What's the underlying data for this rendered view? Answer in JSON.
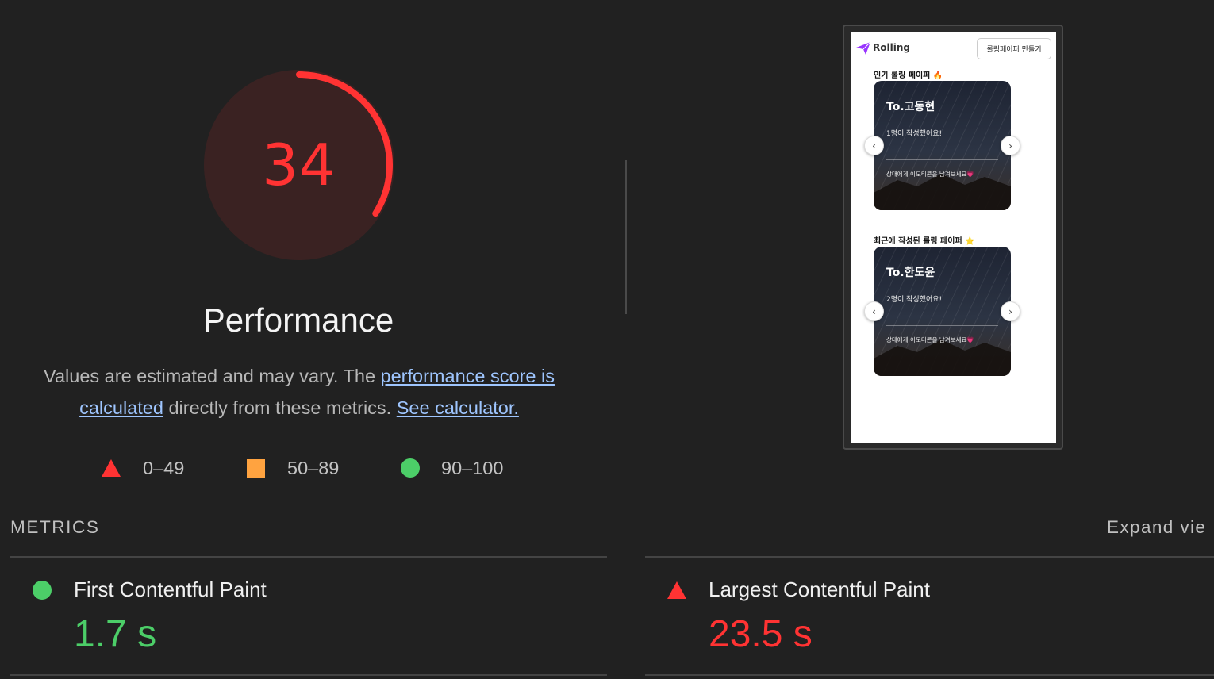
{
  "score": {
    "value": "34",
    "fraction": 0.34,
    "color": "#ff3333"
  },
  "category": "Performance",
  "description": {
    "before": "Values are estimated and may vary. The ",
    "link1": "performance score is calculated",
    "middle": " directly from these metrics. ",
    "link2": "See calculator."
  },
  "legend": [
    {
      "icon": "triangle-icon",
      "label": "0–49",
      "color": "#ff3333"
    },
    {
      "icon": "square-icon",
      "label": "50–89",
      "color": "#ffa340"
    },
    {
      "icon": "circle-icon",
      "label": "90–100",
      "color": "#4cce68"
    }
  ],
  "screenshot": {
    "brand": "Rolling",
    "make_button": "롤링페이퍼 만들기",
    "section1_title": "인기 롤링 페이퍼 🔥",
    "section2_title": "최근에 작성된 롤링 페이퍼 ⭐",
    "card1": {
      "to": "To.고동현",
      "count": "1명이 작성했어요!",
      "cta": "상대에게 이모티콘을 남겨보세요💗"
    },
    "card2": {
      "to": "To.한도윤",
      "count": "2명이 작성했어요!",
      "cta": "상대에게 이모티콘을 남겨보세요💗"
    },
    "prev_glyph": "‹",
    "next_glyph": "›"
  },
  "metrics_title": "METRICS",
  "expand_label": "Expand vie",
  "metrics": [
    {
      "name": "First Contentful Paint",
      "value": "1.7 s",
      "status": "pass",
      "icon": "circle-icon",
      "color": "#4cce68"
    },
    {
      "name": "Largest Contentful Paint",
      "value": "23.5 s",
      "status": "fail",
      "icon": "triangle-icon",
      "color": "#ff3333"
    }
  ]
}
